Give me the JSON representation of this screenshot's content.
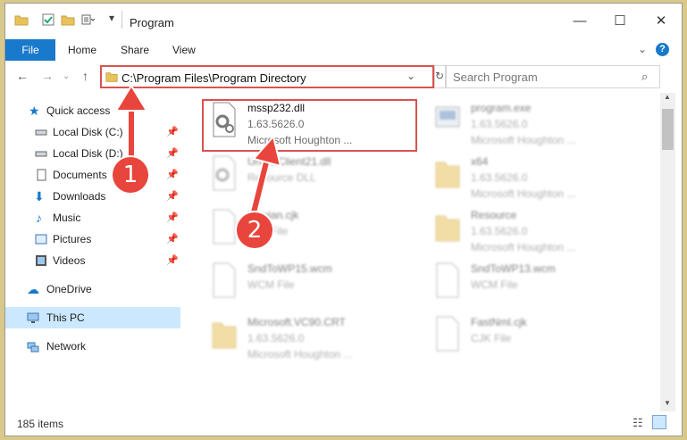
{
  "window": {
    "title": "Program",
    "controls": {
      "minimize": "—",
      "maximize": "☐",
      "close": "✕"
    }
  },
  "ribbon": {
    "tabs": [
      "File",
      "Home",
      "Share",
      "View"
    ],
    "expand_icon": "chevron-down-icon",
    "help_icon": "?"
  },
  "address": {
    "path": "C:\\Program Files\\Program Directory",
    "search_placeholder": "Search Program"
  },
  "sidebar": {
    "quick_access": "Quick access",
    "items": [
      {
        "label": "Local Disk (C:)",
        "icon": "drive-icon"
      },
      {
        "label": "Local Disk (D:)",
        "icon": "drive-icon"
      },
      {
        "label": "Documents",
        "icon": "documents-icon"
      },
      {
        "label": "Downloads",
        "icon": "downloads-icon"
      },
      {
        "label": "Music",
        "icon": "music-icon"
      },
      {
        "label": "Pictures",
        "icon": "pictures-icon"
      },
      {
        "label": "Videos",
        "icon": "videos-icon"
      }
    ],
    "onedrive": "OneDrive",
    "this_pc": "This PC",
    "network": "Network"
  },
  "files": [
    {
      "name": "mssp232.dll",
      "line2": "1.63.5626.0",
      "line3": "Microsoft Houghton ...",
      "icon": "dll-gear-icon"
    },
    {
      "name": "program.exe",
      "line2": "1.63.5626.0",
      "line3": "Microsoft Houghton ...",
      "icon": "exe-icon"
    },
    {
      "name": "UninstClient21.dll",
      "line2": "Resource DLL",
      "line3": "",
      "icon": "dll-gear-icon"
    },
    {
      "name": "x64",
      "line2": "1.63.5626.0",
      "line3": "Microsoft Houghton ...",
      "icon": "folder-icon"
    },
    {
      "name": "Bgwian.cjk",
      "line2": "CJK File",
      "line3": "",
      "icon": "file-icon"
    },
    {
      "name": "Resource",
      "line2": "1.63.5626.0",
      "line3": "Microsoft Houghton ...",
      "icon": "folder-icon"
    },
    {
      "name": "SndToWP15.wcm",
      "line2": "WCM File",
      "line3": "",
      "icon": "file-icon"
    },
    {
      "name": "SndToWP13.wcm",
      "line2": "WCM File",
      "line3": "",
      "icon": "file-icon"
    },
    {
      "name": "Microsoft.VC90.CRT",
      "line2": "1.63.5626.0",
      "line3": "Microsoft Houghton ...",
      "icon": "folder-icon"
    },
    {
      "name": "FastNml.cjk",
      "line2": "CJK File",
      "line3": "",
      "icon": "file-icon"
    }
  ],
  "status": {
    "item_count": "185 items"
  },
  "annotations": {
    "step1": "1",
    "step2": "2"
  },
  "colors": {
    "accent": "#1979ca",
    "highlight": "#d9534f",
    "selected_nav": "#cce8ff"
  }
}
